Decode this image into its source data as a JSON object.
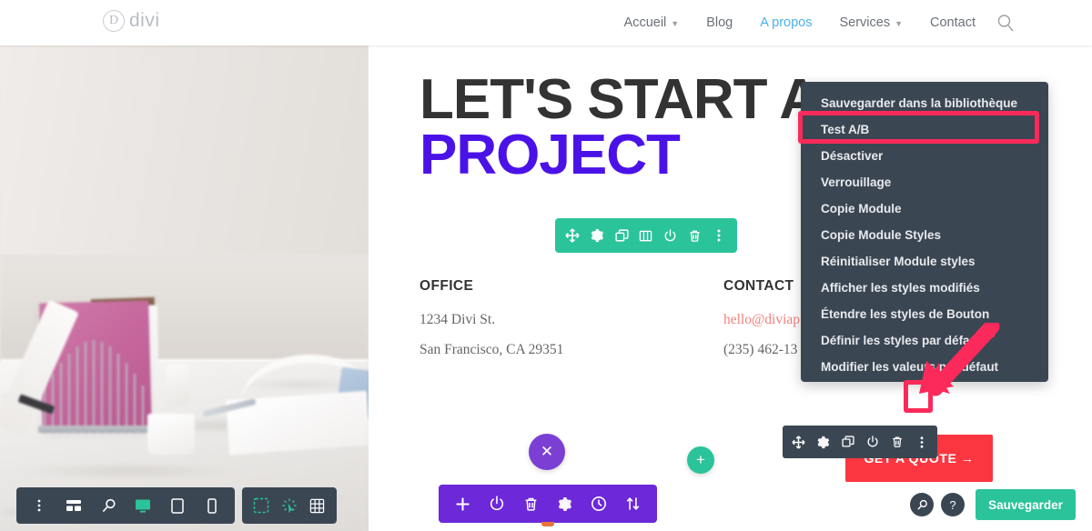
{
  "header": {
    "logo_mark": "D",
    "logo_text": "divi",
    "nav": [
      {
        "label": "Accueil",
        "has_caret": true,
        "active": false
      },
      {
        "label": "Blog",
        "has_caret": false,
        "active": false
      },
      {
        "label": "A propos",
        "has_caret": false,
        "active": true
      },
      {
        "label": "Services",
        "has_caret": true,
        "active": false
      },
      {
        "label": "Contact",
        "has_caret": false,
        "active": false
      }
    ],
    "search_icon": "search-icon"
  },
  "hero": {
    "headline_line1": "LET'S START A",
    "headline_line2": "PROJECT",
    "columns": [
      {
        "title": "OFFICE",
        "lines": [
          "1234 Divi St.",
          "San Francisco, CA 29351"
        ]
      },
      {
        "title": "CONTACT",
        "lines": [
          "hello@diviap",
          "(235) 462-13"
        ]
      }
    ],
    "cta_label": "GET A QUOTE →"
  },
  "module_toolbar": {
    "icons": [
      "move-icon",
      "gear-icon",
      "duplicate-icon",
      "columns-icon",
      "power-icon",
      "trash-icon",
      "kebab-icon"
    ]
  },
  "button_toolbar": {
    "icons": [
      "move-icon",
      "gear-icon",
      "duplicate-icon",
      "power-icon",
      "trash-icon",
      "kebab-icon"
    ]
  },
  "context_menu": {
    "items": [
      {
        "label": "Sauvegarder dans la bibliothèque",
        "highlighted": false
      },
      {
        "label": "Test A/B",
        "highlighted": true
      },
      {
        "label": "Désactiver",
        "highlighted": false
      },
      {
        "label": "Verrouillage",
        "highlighted": false
      },
      {
        "label": "Copie Module",
        "highlighted": false
      },
      {
        "label": "Copie Module Styles",
        "highlighted": false
      },
      {
        "label": "Réinitialiser Module styles",
        "highlighted": false
      },
      {
        "label": "Afficher les styles modifiés",
        "highlighted": false
      },
      {
        "label": "Étendre les styles de Bouton",
        "highlighted": false
      },
      {
        "label": "Définir les styles par défaut",
        "highlighted": false
      },
      {
        "label": "Modifier les valeurs par défaut",
        "highlighted": false
      }
    ]
  },
  "annotations": {
    "highlight_color": "#fb2a5a",
    "arrow_name": "red-arrow-annotation"
  },
  "circles": {
    "close_label": "✕",
    "add_label": "+"
  },
  "viewport_bar": {
    "icons": [
      "kebab-icon",
      "wireframe-icon",
      "zoom-icon",
      "desktop-icon",
      "tablet-icon",
      "phone-icon"
    ],
    "active_icon": "desktop-icon"
  },
  "mode_bar": {
    "icons": [
      "hover-mode-icon",
      "click-mode-icon",
      "grid-mode-icon"
    ]
  },
  "page_toolbar": {
    "icons": [
      "plus-icon",
      "power-icon",
      "trash-icon",
      "gear-icon",
      "history-icon",
      "portability-icon"
    ]
  },
  "footer": {
    "search_icon": "search-icon",
    "help_icon": "help-icon",
    "save_label": "Sauvegarder"
  },
  "colors": {
    "accent_purple": "#4b12e8",
    "toolbar_green": "#2bc39a",
    "toolbar_dark": "#3b4653",
    "toolbar_purple": "#6d28d9",
    "cta_red": "#fb3640",
    "highlight_pink": "#fb2a5a",
    "nav_active_blue": "#4cb0ee"
  }
}
